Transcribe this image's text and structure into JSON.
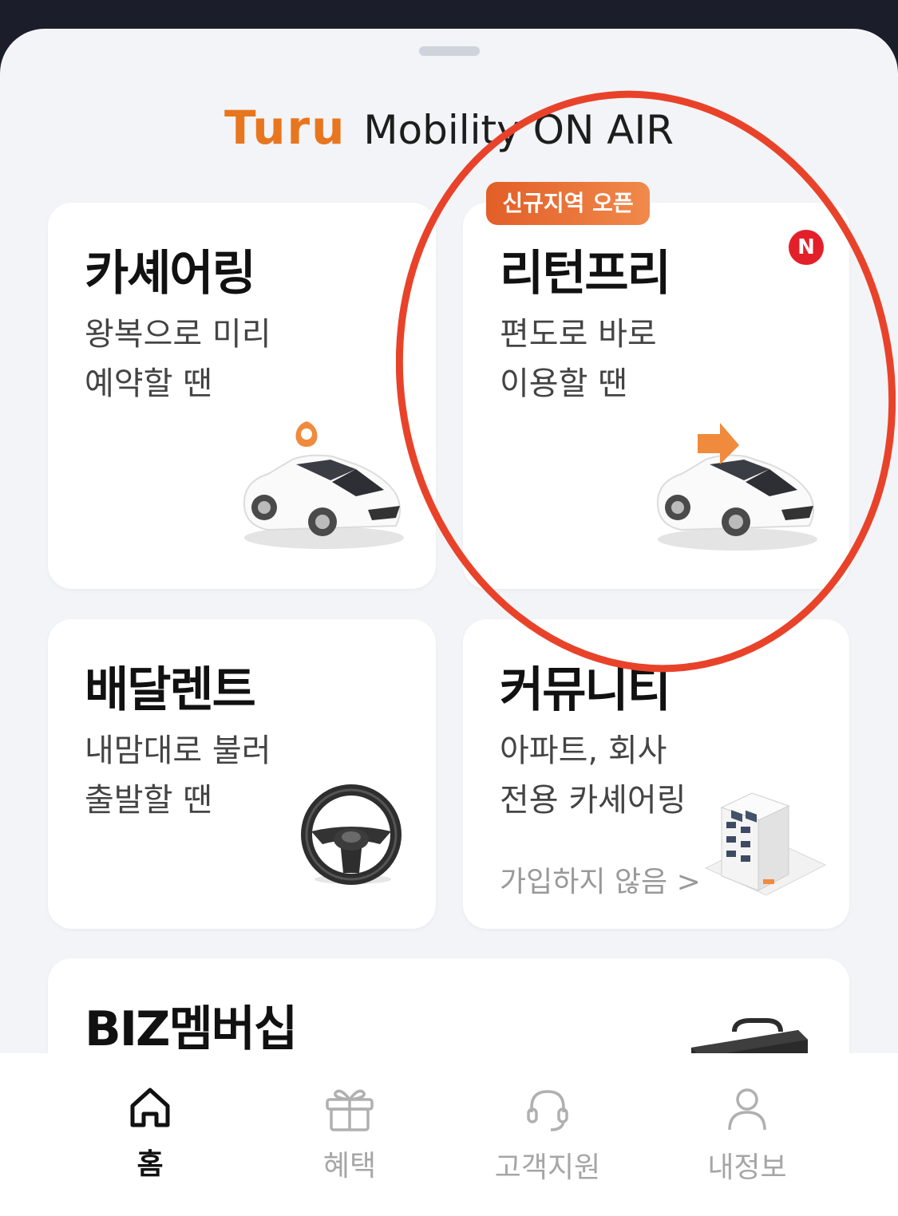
{
  "brand": {
    "logo": "Turu",
    "tagline": "Mobility ON AIR"
  },
  "cards": {
    "carsharing": {
      "title": "카셰어링",
      "desc1": "왕복으로 미리",
      "desc2": "예약할 땐"
    },
    "returnfree": {
      "title": "리턴프리",
      "desc1": "편도로 바로",
      "desc2": "이용할 땐",
      "badge": "신규지역 오픈",
      "new_mark": "N"
    },
    "delivery": {
      "title": "배달렌트",
      "desc1": "내맘대로 불러",
      "desc2": "출발할 땐"
    },
    "community": {
      "title": "커뮤니티",
      "desc1": "아파트, 회사",
      "desc2": "전용 카셰어링",
      "link": "가입하지 않음 >"
    },
    "biz": {
      "title": "BIZ멤버십"
    }
  },
  "nav": {
    "home": "홈",
    "benefits": "혜택",
    "support": "고객지원",
    "myinfo": "내정보"
  },
  "colors": {
    "accent": "#e8761f",
    "annotation": "#e8432a",
    "new_badge": "#e3202a"
  }
}
